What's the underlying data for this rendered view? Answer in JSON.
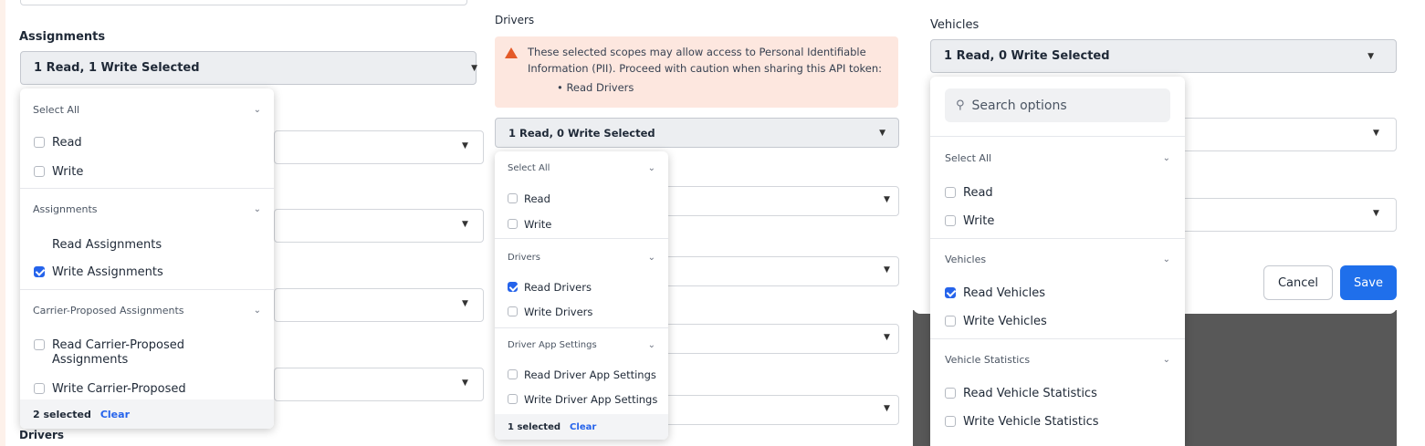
{
  "panel1": {
    "section_label": "Assignments",
    "select_value": "1 Read, 1 Write Selected",
    "dropdown": {
      "select_all": {
        "header": "Select All",
        "options": [
          {
            "label": "Read",
            "checked": false
          },
          {
            "label": "Write",
            "checked": false
          }
        ]
      },
      "assignments": {
        "header": "Assignments",
        "options": [
          {
            "label": "Read Assignments",
            "checked": false
          },
          {
            "label": "Write Assignments",
            "checked": true
          }
        ]
      },
      "carrier": {
        "header": "Carrier-Proposed Assignments",
        "options": [
          {
            "label": "Read Carrier-Proposed Assignments",
            "checked": false
          },
          {
            "label": "Write Carrier-Proposed",
            "checked": false
          }
        ]
      },
      "footer": {
        "count": "2 selected",
        "clear": "Clear"
      }
    },
    "bottom_label": "Drivers"
  },
  "panel2": {
    "section_label": "Drivers",
    "warning": {
      "text": "These selected scopes may allow access to Personal Identifiable Information (PII). Proceed with caution when sharing this API token:",
      "bullet": "Read Drivers"
    },
    "select_value": "1 Read, 0 Write Selected",
    "dropdown": {
      "select_all": {
        "header": "Select All",
        "options": [
          {
            "label": "Read",
            "checked": false
          },
          {
            "label": "Write",
            "checked": false
          }
        ]
      },
      "drivers": {
        "header": "Drivers",
        "options": [
          {
            "label": "Read Drivers",
            "checked": true
          },
          {
            "label": "Write Drivers",
            "checked": false
          }
        ]
      },
      "app_settings": {
        "header": "Driver App Settings",
        "options": [
          {
            "label": "Read Driver App Settings",
            "checked": false
          },
          {
            "label": "Write Driver App Settings",
            "checked": false
          }
        ]
      },
      "footer": {
        "count": "1 selected",
        "clear": "Clear"
      }
    }
  },
  "panel3": {
    "section_label": "Vehicles",
    "select_value": "1 Read, 0 Write Selected",
    "dropdown": {
      "search_placeholder": "Search options",
      "select_all": {
        "header": "Select All",
        "options": [
          {
            "label": "Read",
            "checked": false
          },
          {
            "label": "Write",
            "checked": false
          }
        ]
      },
      "vehicles": {
        "header": "Vehicles",
        "options": [
          {
            "label": "Read Vehicles",
            "checked": true
          },
          {
            "label": "Write Vehicles",
            "checked": false
          }
        ]
      },
      "statistics": {
        "header": "Vehicle Statistics",
        "options": [
          {
            "label": "Read Vehicle Statistics",
            "checked": false
          },
          {
            "label": "Write Vehicle Statistics",
            "checked": false
          }
        ]
      }
    },
    "buttons": {
      "cancel": "Cancel",
      "save": "Save"
    },
    "colors": {
      "overlay": "#585858",
      "accent": "#1f6feb"
    }
  }
}
